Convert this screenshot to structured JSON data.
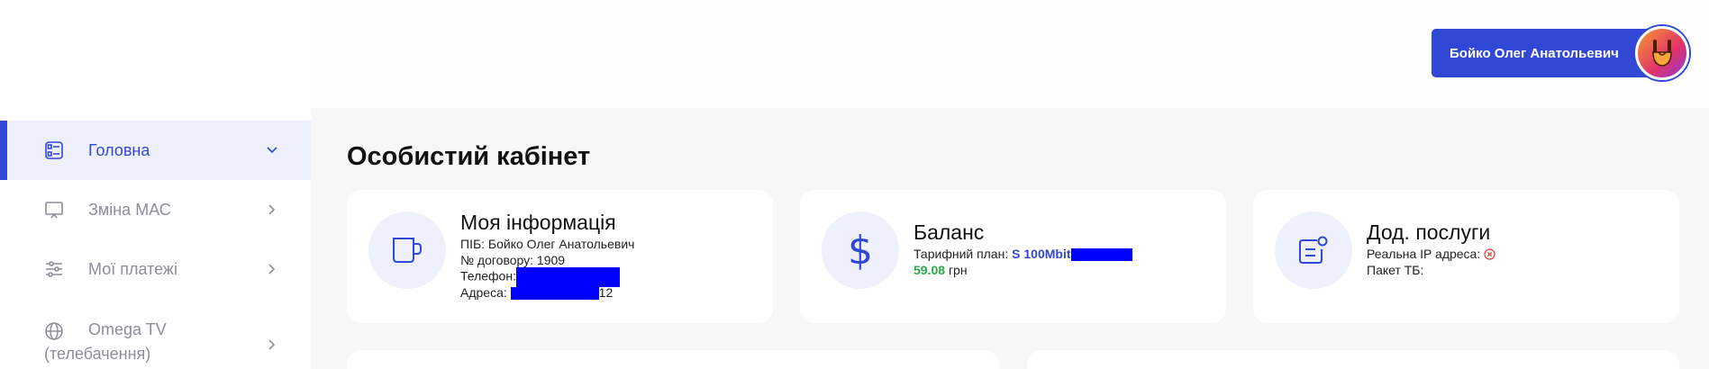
{
  "sidebar": {
    "items": [
      {
        "label": "Головна",
        "icon": "dashboard-icon"
      },
      {
        "label": "Зміна МАС",
        "icon": "monitor-icon"
      },
      {
        "label": "Мої платежі",
        "icon": "sliders-icon"
      },
      {
        "label_line1": "Omega TV",
        "label_line2": "(телебачення)",
        "icon": "globe-icon"
      }
    ]
  },
  "header": {
    "user_name": "Бойко Олег Анатольевич"
  },
  "main": {
    "title": "Особистий кабінет",
    "info_card": {
      "title": "Моя інформація",
      "pib": "ПІБ: Бойко Олег Анатольевич",
      "contract": "№ договору: 1909",
      "phone_label": "Телефон:",
      "address_label": "Адреса:",
      "address_suffix": "12"
    },
    "balance_card": {
      "title": "Баланс",
      "tariff_label": "Тарифний план:",
      "tariff_value": "S 100Mbit",
      "amount": "59.08",
      "currency": "грн"
    },
    "services_card": {
      "title": "Дод. послуги",
      "ip_label": "Реальна IP адреса:",
      "tv_label": "Пакет ТБ:"
    }
  },
  "colors": {
    "accent": "#3148d6",
    "positive": "#29a84a",
    "error": "#e53935",
    "redaction": "#0000ff"
  }
}
